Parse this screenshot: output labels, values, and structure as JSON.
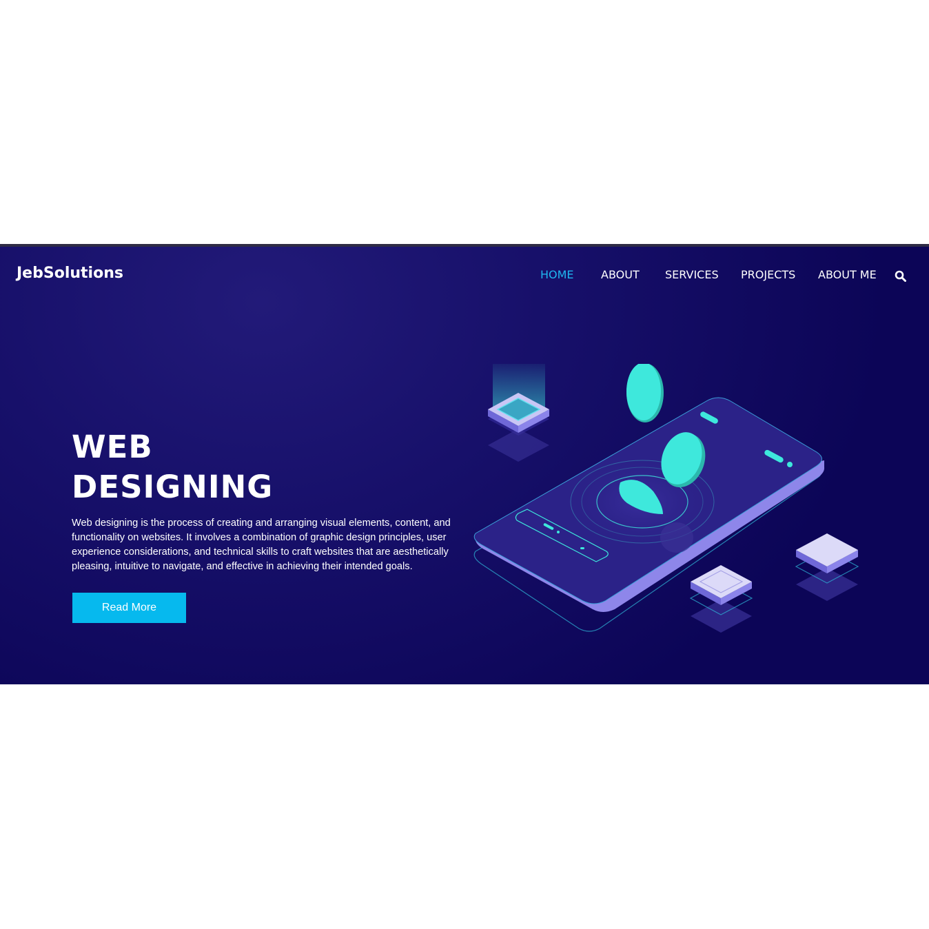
{
  "header": {
    "logo": "JebSolutions",
    "nav": [
      "HOME",
      "ABOUT",
      "SERVICES",
      "PROJECTS",
      "ABOUT ME"
    ],
    "active_nav": "HOME",
    "search_icon": "search-icon"
  },
  "hero": {
    "headline_line1": "WEB",
    "headline_line2": "DESIGNING",
    "description": "Web designing is the process of creating and arranging visual elements, content, and functionality on websites. It involves a combination of graphic design principles, user experience considerations, and technical skills to craft websites that are aesthetically pleasing, intuitive to navigate, and effective in achieving their intended goals.",
    "button_label": "Read More"
  },
  "colors": {
    "accent": "#06b9ee",
    "nav_active": "#1fb6f0",
    "hero_bg": "#17106a",
    "illustration_teal": "#3ee8dc"
  }
}
